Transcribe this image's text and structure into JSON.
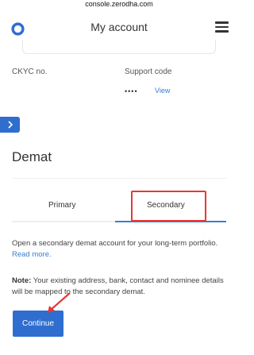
{
  "browser": {
    "url": "console.zerodha.com"
  },
  "header": {
    "title": "My account"
  },
  "details": {
    "ckyc_label": "CKYC no.",
    "support_label": "Support code",
    "support_masked": "••••",
    "view_label": "View"
  },
  "section": {
    "title": "Demat"
  },
  "tabs": [
    {
      "label": "Primary",
      "active": false
    },
    {
      "label": "Secondary",
      "active": true
    }
  ],
  "content": {
    "description": "Open a secondary demat account for your long-term portfolio.",
    "read_more": "Read more.",
    "note_label": "Note:",
    "note_text": " Your existing address, bank, contact and nominee details will be mapped to the secondary demat."
  },
  "actions": {
    "continue_label": "Continue"
  },
  "colors": {
    "accent": "#387ed1",
    "button": "#2f6ecf",
    "highlight": "#e53935"
  },
  "icons": {
    "logo": "zerodha-logo-icon",
    "menu": "hamburger-menu-icon",
    "side": "chevron-right-icon"
  }
}
